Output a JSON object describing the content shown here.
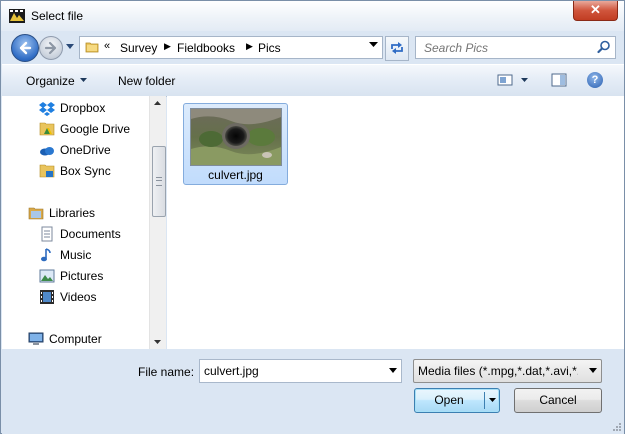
{
  "window": {
    "title": "Select file",
    "close_glyph": "✕"
  },
  "address": {
    "overflow_chevron": "«",
    "breadcrumbs": [
      "Survey",
      "Fieldbooks",
      "Pics"
    ],
    "separator": "▶"
  },
  "search": {
    "placeholder": "Search Pics"
  },
  "toolbar": {
    "organize_label": "Organize",
    "new_folder_label": "New folder",
    "help_glyph": "?"
  },
  "nav_pane": {
    "favorites": [
      {
        "label": "Dropbox",
        "icon": "dropbox-icon"
      },
      {
        "label": "Google Drive",
        "icon": "google-drive-icon"
      },
      {
        "label": "OneDrive",
        "icon": "onedrive-icon"
      },
      {
        "label": "Box Sync",
        "icon": "box-sync-icon"
      }
    ],
    "libraries": {
      "label": "Libraries",
      "items": [
        {
          "label": "Documents",
          "icon": "documents-icon"
        },
        {
          "label": "Music",
          "icon": "music-icon"
        },
        {
          "label": "Pictures",
          "icon": "pictures-icon"
        },
        {
          "label": "Videos",
          "icon": "videos-icon"
        }
      ]
    },
    "computer": {
      "label": "Computer"
    }
  },
  "files": [
    {
      "name": "culvert.jpg",
      "selected": true
    }
  ],
  "file_name": {
    "label": "File name:",
    "value": "culvert.jpg"
  },
  "file_type": {
    "selected": "Media files (*.mpg,*.dat,*.avi,*.wmv)"
  },
  "buttons": {
    "open": "Open",
    "cancel": "Cancel"
  },
  "colors": {
    "accent": "#3c7fb1",
    "selection": "#c1dcfc",
    "window_bg": "#dbe6f3"
  }
}
